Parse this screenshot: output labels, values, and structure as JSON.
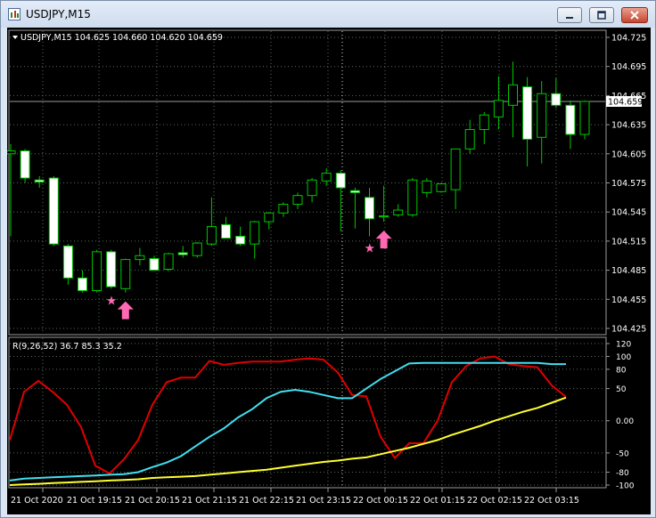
{
  "window": {
    "title": "USDJPY,M15",
    "icon": "chart-window-icon",
    "buttons": [
      "minimize-icon",
      "maximize-icon",
      "close-icon"
    ]
  },
  "colors": {
    "background": "#000000",
    "grid": "#5a6b5a",
    "bull_candle": "#00c800",
    "bear_candle_body": "#ffffff",
    "signal": "#ff69b4",
    "line_red": "#e00000",
    "line_cyan": "#40e0f0",
    "line_yellow": "#ffff30"
  },
  "main_chart": {
    "header_text": "USDJPY,M15  104.625 104.660 104.620 104.659",
    "current_price_label": "104.659",
    "price_ticks": [
      "104.725",
      "104.695",
      "104.665",
      "104.635",
      "104.605",
      "104.575",
      "104.545",
      "104.515",
      "104.485",
      "104.455",
      "104.425"
    ],
    "signal_markers": [
      {
        "type": "star",
        "candle_index": 7
      },
      {
        "type": "arrow-up",
        "candle_index": 8
      },
      {
        "type": "star",
        "candle_index": 25
      },
      {
        "type": "arrow-up",
        "candle_index": 26
      }
    ]
  },
  "indicator": {
    "header_text": "R(9,26,52) 36.7 85.3 35.2",
    "ticks": [
      "120",
      "100",
      "80",
      "50",
      "0.00",
      "-50",
      "-80",
      "-100"
    ]
  },
  "time_axis": {
    "labels": [
      "21 Oct 2020",
      "21 Oct 19:15",
      "21 Oct 20:15",
      "21 Oct 21:15",
      "21 Oct 22:15",
      "21 Oct 23:15",
      "22 Oct 00:15",
      "22 Oct 01:15",
      "22 Oct 02:15",
      "22 Oct 03:15"
    ]
  },
  "chart_data": [
    {
      "type": "candlestick",
      "symbol": "USDJPY",
      "timeframe": "M15",
      "ylim": [
        104.425,
        104.725
      ],
      "candles": [
        {
          "o": 104.605,
          "h": 104.615,
          "l": 104.52,
          "c": 104.608
        },
        {
          "o": 104.608,
          "h": 104.61,
          "l": 104.575,
          "c": 104.58
        },
        {
          "o": 104.578,
          "h": 104.582,
          "l": 104.57,
          "c": 104.576
        },
        {
          "o": 104.58,
          "h": 104.582,
          "l": 104.51,
          "c": 104.512
        },
        {
          "o": 104.51,
          "h": 104.512,
          "l": 104.47,
          "c": 104.477
        },
        {
          "o": 104.477,
          "h": 104.485,
          "l": 104.462,
          "c": 104.464
        },
        {
          "o": 104.464,
          "h": 104.506,
          "l": 104.462,
          "c": 104.504
        },
        {
          "o": 104.504,
          "h": 104.506,
          "l": 104.466,
          "c": 104.468
        },
        {
          "o": 104.466,
          "h": 104.497,
          "l": 104.462,
          "c": 104.496
        },
        {
          "o": 104.496,
          "h": 104.508,
          "l": 104.49,
          "c": 104.5
        },
        {
          "o": 104.497,
          "h": 104.5,
          "l": 104.485,
          "c": 104.485
        },
        {
          "o": 104.486,
          "h": 104.503,
          "l": 104.484,
          "c": 104.502
        },
        {
          "o": 104.503,
          "h": 104.51,
          "l": 104.498,
          "c": 104.501
        },
        {
          "o": 104.5,
          "h": 104.514,
          "l": 104.498,
          "c": 104.513
        },
        {
          "o": 104.512,
          "h": 104.56,
          "l": 104.51,
          "c": 104.53
        },
        {
          "o": 104.532,
          "h": 104.54,
          "l": 104.518,
          "c": 104.518
        },
        {
          "o": 104.52,
          "h": 104.53,
          "l": 104.51,
          "c": 104.512
        },
        {
          "o": 104.512,
          "h": 104.536,
          "l": 104.497,
          "c": 104.535
        },
        {
          "o": 104.535,
          "h": 104.545,
          "l": 104.527,
          "c": 104.544
        },
        {
          "o": 104.544,
          "h": 104.555,
          "l": 104.54,
          "c": 104.553
        },
        {
          "o": 104.553,
          "h": 104.565,
          "l": 104.548,
          "c": 104.562
        },
        {
          "o": 104.562,
          "h": 104.58,
          "l": 104.555,
          "c": 104.578
        },
        {
          "o": 104.577,
          "h": 104.59,
          "l": 104.572,
          "c": 104.585
        },
        {
          "o": 104.585,
          "h": 104.588,
          "l": 104.525,
          "c": 104.57
        },
        {
          "o": 104.567,
          "h": 104.57,
          "l": 104.528,
          "c": 104.565
        },
        {
          "o": 104.56,
          "h": 104.57,
          "l": 104.52,
          "c": 104.538
        },
        {
          "o": 104.54,
          "h": 104.572,
          "l": 104.535,
          "c": 104.541
        },
        {
          "o": 104.542,
          "h": 104.553,
          "l": 104.54,
          "c": 104.547
        },
        {
          "o": 104.542,
          "h": 104.58,
          "l": 104.54,
          "c": 104.578
        },
        {
          "o": 104.565,
          "h": 104.58,
          "l": 104.56,
          "c": 104.577
        },
        {
          "o": 104.566,
          "h": 104.575,
          "l": 104.565,
          "c": 104.574
        },
        {
          "o": 104.568,
          "h": 104.61,
          "l": 104.548,
          "c": 104.61
        },
        {
          "o": 104.61,
          "h": 104.64,
          "l": 104.605,
          "c": 104.63
        },
        {
          "o": 104.63,
          "h": 104.648,
          "l": 104.615,
          "c": 104.645
        },
        {
          "o": 104.643,
          "h": 104.685,
          "l": 104.63,
          "c": 104.66
        },
        {
          "o": 104.655,
          "h": 104.7,
          "l": 104.622,
          "c": 104.676
        },
        {
          "o": 104.674,
          "h": 104.684,
          "l": 104.592,
          "c": 104.62
        },
        {
          "o": 104.622,
          "h": 104.68,
          "l": 104.595,
          "c": 104.667
        },
        {
          "o": 104.667,
          "h": 104.683,
          "l": 104.652,
          "c": 104.655
        },
        {
          "o": 104.655,
          "h": 104.66,
          "l": 104.61,
          "c": 104.625
        },
        {
          "o": 104.625,
          "h": 104.66,
          "l": 104.62,
          "c": 104.659
        }
      ]
    },
    {
      "type": "line",
      "title": "R(9,26,52)",
      "ylim": [
        -100,
        120
      ],
      "series": [
        {
          "name": "red",
          "values": [
            -30,
            45,
            62,
            45,
            25,
            -10,
            -70,
            -82,
            -60,
            -30,
            25,
            60,
            67,
            67,
            93,
            87,
            90,
            92,
            92,
            92,
            95,
            97,
            95,
            75,
            40,
            38,
            -25,
            -58,
            -35,
            -35,
            0,
            60,
            85,
            97,
            100,
            88,
            85,
            83,
            55,
            37
          ]
        },
        {
          "name": "cyan",
          "values": [
            -93,
            -90,
            -89,
            -88,
            -87,
            -86,
            -85,
            -84,
            -83,
            -80,
            -72,
            -65,
            -55,
            -40,
            -25,
            -12,
            5,
            18,
            35,
            45,
            48,
            45,
            40,
            35,
            35,
            50,
            65,
            77,
            89,
            90,
            90,
            90,
            90,
            90,
            90,
            90,
            90,
            90,
            88,
            88
          ]
        },
        {
          "name": "yellow",
          "values": [
            -100,
            -99,
            -98,
            -97,
            -96,
            -95,
            -94,
            -93,
            -92,
            -91,
            -89,
            -88,
            -87,
            -86,
            -84,
            -82,
            -80,
            -78,
            -76,
            -73,
            -70,
            -67,
            -64,
            -62,
            -59,
            -57,
            -52,
            -47,
            -42,
            -36,
            -30,
            -22,
            -15,
            -8,
            0,
            7,
            14,
            20,
            28,
            36
          ]
        }
      ]
    }
  ]
}
